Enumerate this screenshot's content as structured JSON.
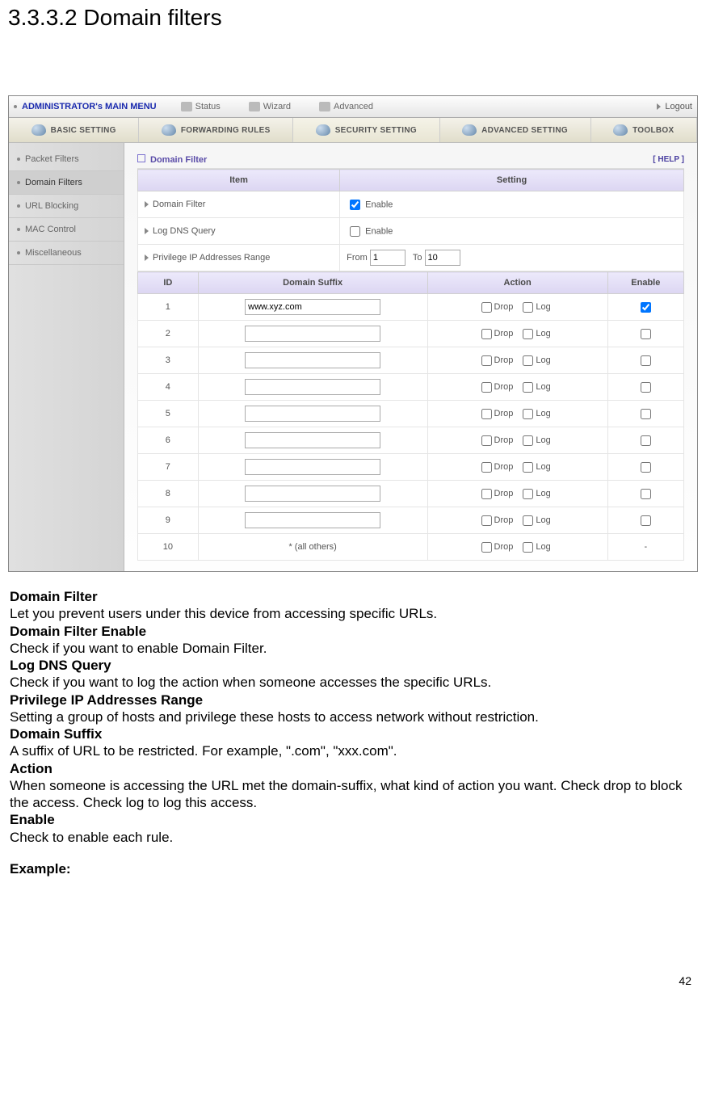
{
  "doc": {
    "heading": "3.3.3.2 Domain filters",
    "page_number": "42"
  },
  "topbar": {
    "title_label": "ADMINISTRATOR's MAIN MENU",
    "nav": [
      "Status",
      "Wizard",
      "Advanced"
    ],
    "logout": "Logout"
  },
  "tabs": {
    "items": [
      "BASIC SETTING",
      "FORWARDING RULES",
      "SECURITY SETTING",
      "ADVANCED SETTING",
      "TOOLBOX"
    ],
    "active_index": 2
  },
  "sidebar": {
    "items": [
      "Packet Filters",
      "Domain Filters",
      "URL Blocking",
      "MAC Control",
      "Miscellaneous"
    ],
    "active_index": 1
  },
  "panel": {
    "title": "Domain Filter",
    "help": "[ HELP ]",
    "settings_headers": {
      "item": "Item",
      "setting": "Setting"
    },
    "setting_rows": [
      {
        "label": "Domain Filter",
        "type": "check",
        "check_label": "Enable",
        "checked": true
      },
      {
        "label": "Log DNS Query",
        "type": "check",
        "check_label": "Enable",
        "checked": false
      },
      {
        "label": "Privilege IP Addresses Range",
        "type": "range",
        "from_label": "From",
        "to_label": "To",
        "from_val": "1",
        "to_val": "10"
      }
    ],
    "rules_headers": {
      "id": "ID",
      "suffix": "Domain Suffix",
      "action": "Action",
      "enable": "Enable"
    },
    "action_labels": {
      "drop": "Drop",
      "log": "Log"
    },
    "rules": [
      {
        "id": "1",
        "suffix": "www.xyz.com",
        "drop": false,
        "log": false,
        "enable": true,
        "has_enable": true,
        "has_input": true
      },
      {
        "id": "2",
        "suffix": "",
        "drop": false,
        "log": false,
        "enable": false,
        "has_enable": true,
        "has_input": true
      },
      {
        "id": "3",
        "suffix": "",
        "drop": false,
        "log": false,
        "enable": false,
        "has_enable": true,
        "has_input": true
      },
      {
        "id": "4",
        "suffix": "",
        "drop": false,
        "log": false,
        "enable": false,
        "has_enable": true,
        "has_input": true
      },
      {
        "id": "5",
        "suffix": "",
        "drop": false,
        "log": false,
        "enable": false,
        "has_enable": true,
        "has_input": true
      },
      {
        "id": "6",
        "suffix": "",
        "drop": false,
        "log": false,
        "enable": false,
        "has_enable": true,
        "has_input": true
      },
      {
        "id": "7",
        "suffix": "",
        "drop": false,
        "log": false,
        "enable": false,
        "has_enable": true,
        "has_input": true
      },
      {
        "id": "8",
        "suffix": "",
        "drop": false,
        "log": false,
        "enable": false,
        "has_enable": true,
        "has_input": true
      },
      {
        "id": "9",
        "suffix": "",
        "drop": false,
        "log": false,
        "enable": false,
        "has_enable": true,
        "has_input": true
      },
      {
        "id": "10",
        "suffix": "* (all others)",
        "drop": false,
        "log": false,
        "enable": false,
        "has_enable": false,
        "has_input": false
      }
    ]
  },
  "description": {
    "items": [
      {
        "head": "Domain Filter",
        "body": "Let you prevent users under this device from accessing specific URLs."
      },
      {
        "head": "Domain Filter Enable",
        "body": "Check if you want to enable Domain Filter."
      },
      {
        "head": "Log DNS Query",
        "body": "Check if you want to log the action when someone accesses the specific URLs."
      },
      {
        "head": "Privilege IP Addresses Range",
        "body": "Setting a group of hosts and privilege these hosts to access network without restriction."
      },
      {
        "head": "Domain Suffix",
        "body": "A suffix of URL to be restricted. For example, \".com\", \"xxx.com\"."
      },
      {
        "head": "Action",
        "body": "When someone is accessing the URL met the domain-suffix, what kind of action you want. Check drop to block the access. Check log to log this access."
      },
      {
        "head": "Enable",
        "body": "Check to enable each rule."
      }
    ],
    "example_label": "Example:"
  }
}
